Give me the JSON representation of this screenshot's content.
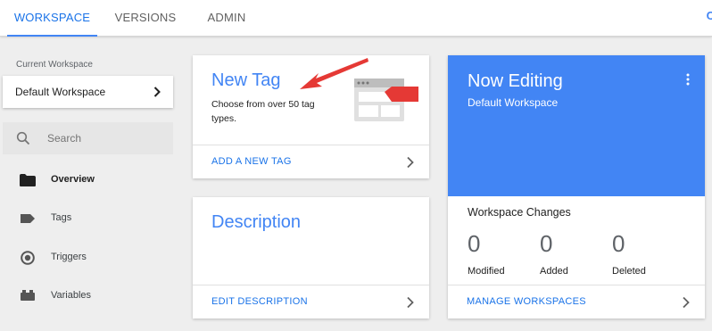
{
  "tabs": [
    {
      "label": "WORKSPACE",
      "active": true
    },
    {
      "label": "VERSIONS",
      "active": false
    },
    {
      "label": "ADMIN",
      "active": false
    }
  ],
  "sidebar": {
    "workspace_label": "Current Workspace",
    "workspace_name": "Default Workspace",
    "search_placeholder": "Search",
    "items": [
      {
        "label": "Overview",
        "icon": "folder-icon",
        "active": true
      },
      {
        "label": "Tags",
        "icon": "tag-icon"
      },
      {
        "label": "Triggers",
        "icon": "trigger-icon"
      },
      {
        "label": "Variables",
        "icon": "variables-icon"
      }
    ]
  },
  "new_tag_card": {
    "title": "New Tag",
    "description": "Choose from over 50 tag types.",
    "link": "ADD A NEW TAG"
  },
  "description_card": {
    "title": "Description",
    "link": "EDIT DESCRIPTION"
  },
  "editing_card": {
    "title": "Now Editing",
    "workspace": "Default Workspace",
    "changes_label": "Workspace Changes",
    "stats": [
      {
        "value": "0",
        "label": "Modified"
      },
      {
        "value": "0",
        "label": "Added"
      },
      {
        "value": "0",
        "label": "Deleted"
      }
    ],
    "link": "MANAGE WORKSPACES"
  },
  "colors": {
    "accent": "#4285f4",
    "link": "#1a73e8",
    "annotation_arrow": "#e53935"
  }
}
